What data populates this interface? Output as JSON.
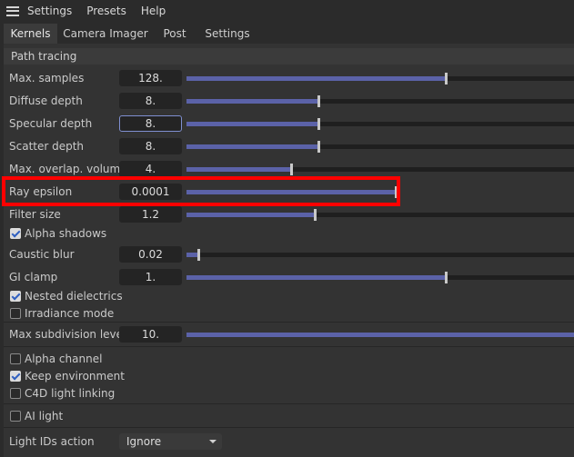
{
  "menubar": {
    "items": [
      "Settings",
      "Presets",
      "Help"
    ]
  },
  "tabs": [
    {
      "label": "Kernels",
      "active": true
    },
    {
      "label": "Camera Imager",
      "active": false
    },
    {
      "label": "Post",
      "active": false
    },
    {
      "label": "Settings",
      "active": false
    }
  ],
  "section": {
    "title": "Path tracing"
  },
  "params": {
    "max_samples": {
      "label": "Max. samples",
      "value": "128.",
      "slider_fraction": 0.67
    },
    "diffuse_depth": {
      "label": "Diffuse depth",
      "value": "8.",
      "slider_fraction": 0.34
    },
    "specular_depth": {
      "label": "Specular depth",
      "value": "8.",
      "slider_fraction": 0.34
    },
    "scatter_depth": {
      "label": "Scatter depth",
      "value": "8.",
      "slider_fraction": 0.34
    },
    "max_overlap_volumes": {
      "label": "Max. overlap. volumes",
      "value": "4.",
      "slider_fraction": 0.27
    },
    "ray_epsilon": {
      "label": "Ray epsilon",
      "value": "0.0001",
      "slider_fraction": 0.54
    },
    "filter_size": {
      "label": "Filter size",
      "value": "1.2",
      "slider_fraction": 0.33
    },
    "alpha_shadows": {
      "label": "Alpha shadows",
      "checked": true
    },
    "caustic_blur": {
      "label": "Caustic blur",
      "value": "0.02",
      "slider_fraction": 0.03
    },
    "gi_clamp": {
      "label": "GI clamp",
      "value": "1.",
      "slider_fraction": 0.67
    },
    "nested_dielectrics": {
      "label": "Nested dielectrics",
      "checked": true
    },
    "irradiance_mode": {
      "label": "Irradiance mode",
      "checked": false
    },
    "max_subdivision_level": {
      "label": "Max subdivision level",
      "value": "10.",
      "slider_fraction": 1.0
    },
    "alpha_channel": {
      "label": "Alpha channel",
      "checked": false
    },
    "keep_environment": {
      "label": "Keep environment",
      "checked": true
    },
    "c4d_light_linking": {
      "label": "C4D light linking",
      "checked": false
    },
    "ai_light": {
      "label": "AI light",
      "checked": false
    },
    "light_ids_action": {
      "label": "Light IDs action",
      "value": "Ignore"
    }
  },
  "colors": {
    "slider_fill": "#5b62a8",
    "highlight": "#ff0000",
    "focus_border": "#7f8fd0"
  }
}
